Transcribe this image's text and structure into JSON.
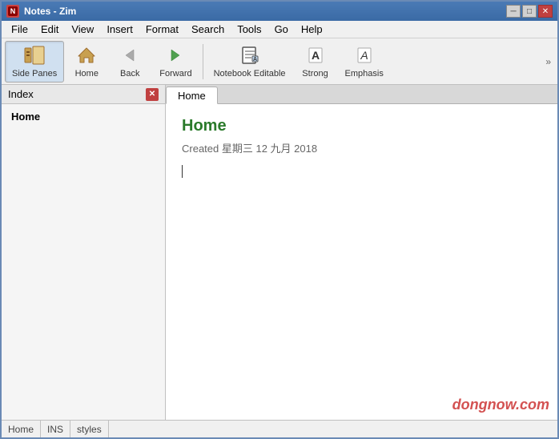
{
  "window": {
    "title": "Notes - Zim",
    "title_icon": "📝"
  },
  "titlebar": {
    "minimize_label": "─",
    "maximize_label": "□",
    "close_label": "✕"
  },
  "menubar": {
    "items": [
      {
        "label": "File"
      },
      {
        "label": "Edit"
      },
      {
        "label": "View"
      },
      {
        "label": "Insert"
      },
      {
        "label": "Format"
      },
      {
        "label": "Search"
      },
      {
        "label": "Tools"
      },
      {
        "label": "Go"
      },
      {
        "label": "Help"
      }
    ]
  },
  "toolbar": {
    "buttons": [
      {
        "name": "side-panes-button",
        "label": "Side Panes",
        "icon": "side-panes-icon",
        "active": true
      },
      {
        "name": "home-button",
        "label": "Home",
        "icon": "home-icon",
        "active": false
      },
      {
        "name": "back-button",
        "label": "Back",
        "icon": "back-icon",
        "active": false
      },
      {
        "name": "forward-button",
        "label": "Forward",
        "icon": "forward-icon",
        "active": false
      },
      {
        "name": "notebook-editable-button",
        "label": "Notebook Editable",
        "icon": "notebook-icon",
        "active": false
      },
      {
        "name": "strong-button",
        "label": "Strong",
        "icon": "strong-icon",
        "active": false
      },
      {
        "name": "emphasis-button",
        "label": "Emphasis",
        "icon": "emphasis-icon",
        "active": false
      }
    ],
    "more_label": "»"
  },
  "sidepanel": {
    "title": "Index",
    "items": [
      {
        "label": "Home"
      }
    ]
  },
  "tabs": [
    {
      "label": "Home",
      "active": true
    }
  ],
  "editor": {
    "page_title": "Home",
    "page_meta": "Created 星期三 12 九月 2018"
  },
  "statusbar": {
    "path": "Home",
    "col_label": "INS",
    "style_label": "styles"
  },
  "watermark": "dongnow.com"
}
